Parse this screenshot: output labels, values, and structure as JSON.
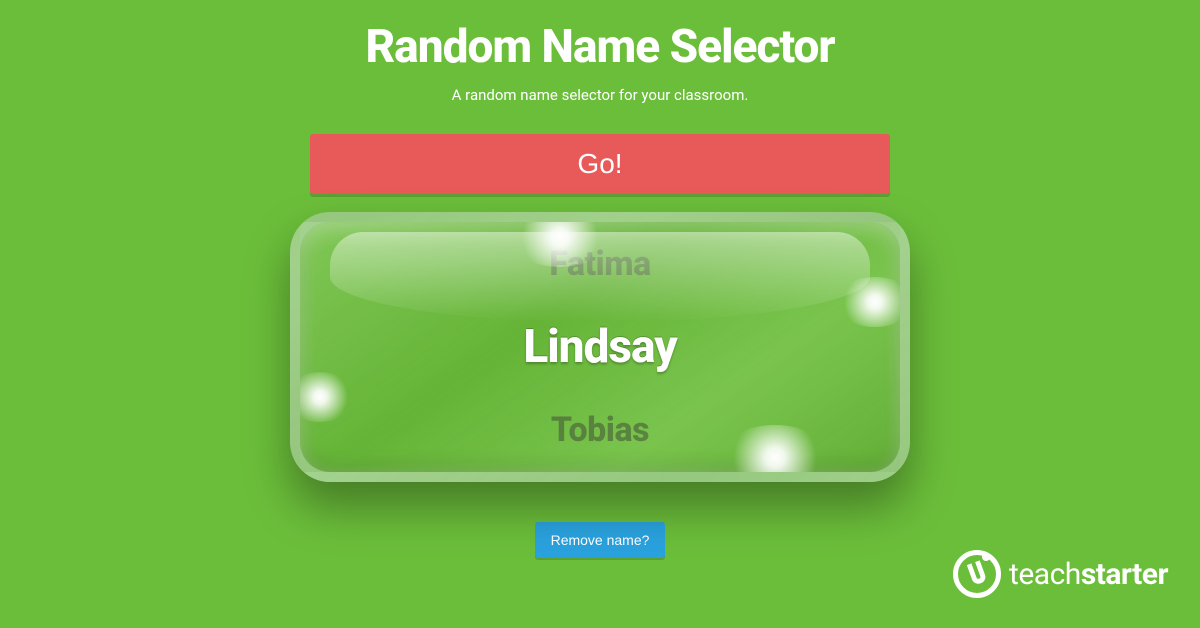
{
  "header": {
    "title": "Random Name Selector",
    "subtitle": "A random name selector for your classroom."
  },
  "buttons": {
    "go": "Go!",
    "remove": "Remove name?"
  },
  "spinner": {
    "prev": "Fatima",
    "selected": "Lindsay",
    "next": "Tobias"
  },
  "brand": {
    "name_light": "teach",
    "name_bold": "starter"
  },
  "colors": {
    "background": "#6bbe3a",
    "go_button": "#e85a5a",
    "remove_button": "#2aa2de"
  }
}
